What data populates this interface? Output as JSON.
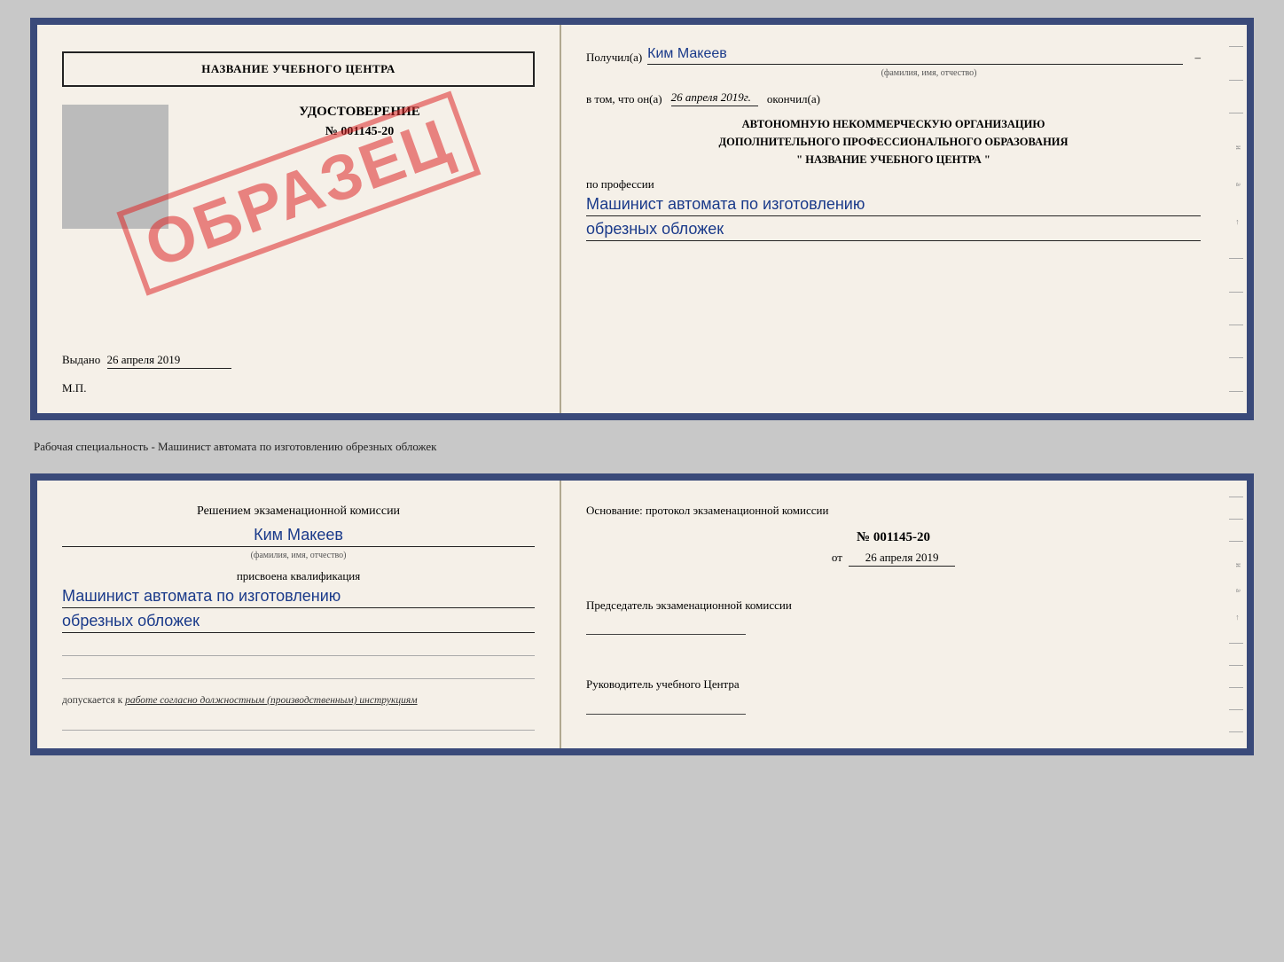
{
  "top_doc": {
    "left": {
      "school_name": "НАЗВАНИЕ УЧЕБНОГО ЦЕНТРА",
      "cert_title": "УДОСТОВЕРЕНИЕ",
      "cert_number": "№ 001145-20",
      "issued_label": "Выдано",
      "issued_date": "26 апреля 2019",
      "mp_label": "М.П.",
      "stamp_text": "ОБРАЗЕЦ"
    },
    "right": {
      "recipient_label": "Получил(а)",
      "recipient_name": "Ким Макеев",
      "recipient_sub": "(фамилия, имя, отчество)",
      "date_label": "в том, что он(а)",
      "date_value": "26 апреля 2019г.",
      "completed_label": "окончил(а)",
      "org_line1": "АВТОНОМНУЮ НЕКОММЕРЧЕСКУЮ ОРГАНИЗАЦИЮ",
      "org_line2": "ДОПОЛНИТЕЛЬНОГО ПРОФЕССИОНАЛЬНОГО ОБРАЗОВАНИЯ",
      "org_line3": "\" НАЗВАНИЕ УЧЕБНОГО ЦЕНТРА \"",
      "profession_label": "по профессии",
      "profession_line1": "Машинист автомата по изготовлению",
      "profession_line2": "обрезных обложек"
    }
  },
  "between_text": "Рабочая специальность - Машинист автомата по изготовлению обрезных обложек",
  "bottom_doc": {
    "left": {
      "commission_intro": "Решением экзаменационной комиссии",
      "person_name": "Ким Макеев",
      "person_sub": "(фамилия, имя, отчество)",
      "qual_label": "присвоена квалификация",
      "qual_line1": "Машинист автомата по изготовлению",
      "qual_line2": "обрезных обложек",
      "note_intro": "допускается к",
      "note_text": "работе согласно должностным (производственным) инструкциям"
    },
    "right": {
      "basis_label": "Основание: протокол экзаменационной комиссии",
      "protocol_number": "№ 001145-20",
      "protocol_date_prefix": "от",
      "protocol_date": "26 апреля 2019",
      "chairman_label": "Председатель экзаменационной комиссии",
      "director_label": "Руководитель учебного Центра"
    }
  },
  "right_margin": {
    "chars": [
      "и",
      "а",
      "←"
    ]
  }
}
